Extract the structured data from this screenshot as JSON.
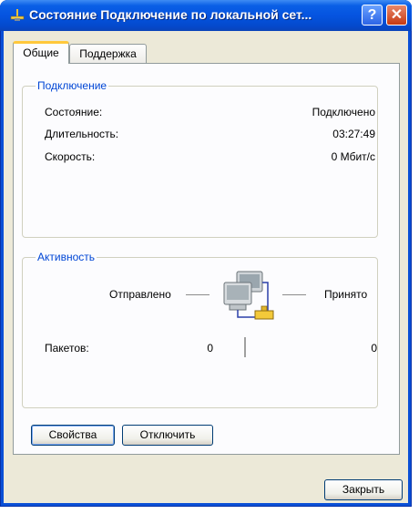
{
  "window": {
    "title": "Состояние Подключение по локальной сет...",
    "help_symbol": "?",
    "close_symbol": "✕"
  },
  "tabs": [
    {
      "label": "Общие",
      "active": true
    },
    {
      "label": "Поддержка",
      "active": false
    }
  ],
  "connection": {
    "legend": "Подключение",
    "rows": [
      {
        "label": "Состояние:",
        "value": "Подключено"
      },
      {
        "label": "Длительность:",
        "value": "03:27:49"
      },
      {
        "label": "Скорость:",
        "value": "0 Мбит/с"
      }
    ]
  },
  "activity": {
    "legend": "Активность",
    "sent_label": "Отправлено",
    "received_label": "Принято",
    "packets_label": "Пакетов:",
    "packets_sent": "0",
    "packets_received": "0",
    "icon": "network-computers-icon"
  },
  "buttons": {
    "properties": "Свойства",
    "disconnect": "Отключить",
    "close": "Закрыть"
  },
  "colors": {
    "titlebar": "#0554e0",
    "client_bg": "#ece9d8",
    "legend_text": "#0046d5",
    "tab_highlight": "#ffc83c"
  }
}
